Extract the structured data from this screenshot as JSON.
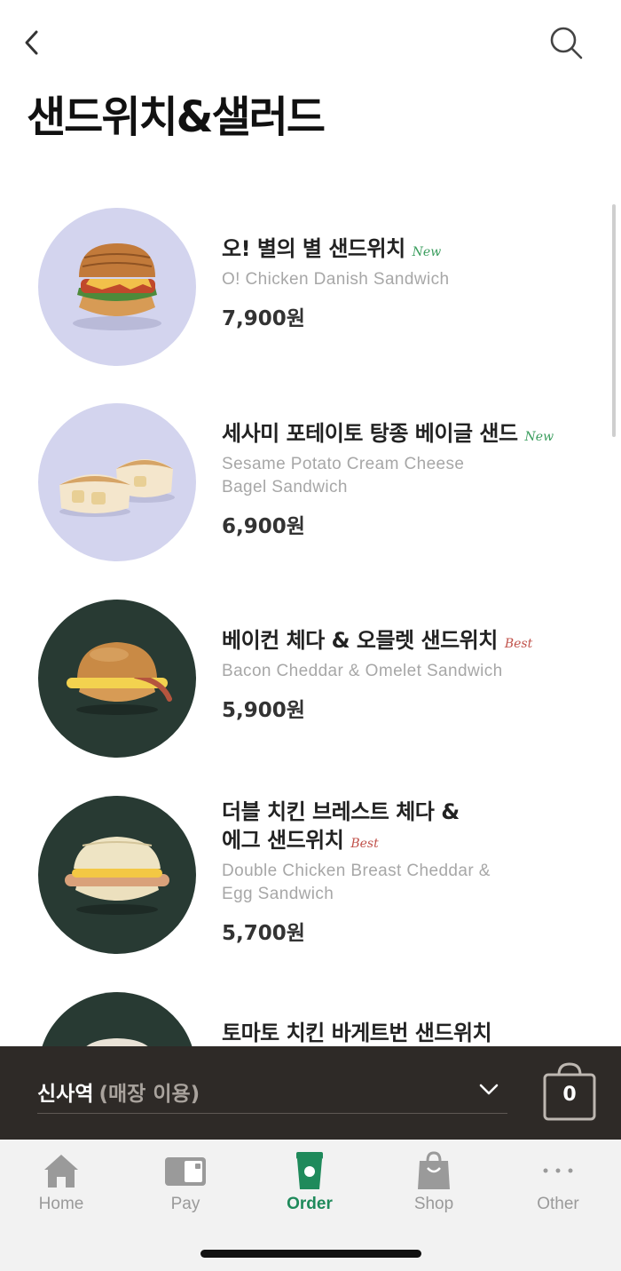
{
  "header": {
    "title": "샌드위치&샐러드",
    "back_icon": "chevron-left-icon",
    "search_icon": "search-icon"
  },
  "products": [
    {
      "name_ko": "오! 별의 별 샌드위치",
      "badge": "New",
      "name_en": [
        "O! Chicken Danish Sandwich"
      ],
      "price": "7,900원"
    },
    {
      "name_ko": "세사미 포테이토 탕종 베이글 샌드",
      "badge": "New",
      "name_en": [
        "Sesame Potato Cream Cheese",
        "Bagel Sandwich"
      ],
      "price": "6,900원"
    },
    {
      "name_ko": "베이컨 체다 & 오믈렛 샌드위치",
      "badge": "Best",
      "name_en": [
        "Bacon Cheddar & Omelet Sandwich"
      ],
      "price": "5,900원"
    },
    {
      "name_ko_lines": [
        "더블 치킨 브레스트 체다 &",
        "에그 샌드위치"
      ],
      "badge": "Best",
      "name_en": [
        "Double Chicken Breast Cheddar &",
        "Egg Sandwich"
      ],
      "price": "5,700원"
    },
    {
      "name_ko": "토마토 치킨 바게트번 샌드위치"
    }
  ],
  "store_bar": {
    "store_name": "신사역",
    "store_mode": "(매장 이용)",
    "cart_count": "0"
  },
  "tabbar": {
    "tabs": [
      {
        "label": "Home",
        "icon": "home-icon"
      },
      {
        "label": "Pay",
        "icon": "card-icon"
      },
      {
        "label": "Order",
        "icon": "cup-icon",
        "active": true
      },
      {
        "label": "Shop",
        "icon": "shopping-bag-icon"
      },
      {
        "label": "Other",
        "icon": "more-icon"
      }
    ]
  },
  "colors": {
    "accent": "#1f8a5b",
    "new_badge": "#3a9d5d",
    "best_badge": "#c0514a",
    "store_bar": "#2e2a27",
    "thumb_light": "#d3d4ee",
    "thumb_dark": "#283a33"
  }
}
